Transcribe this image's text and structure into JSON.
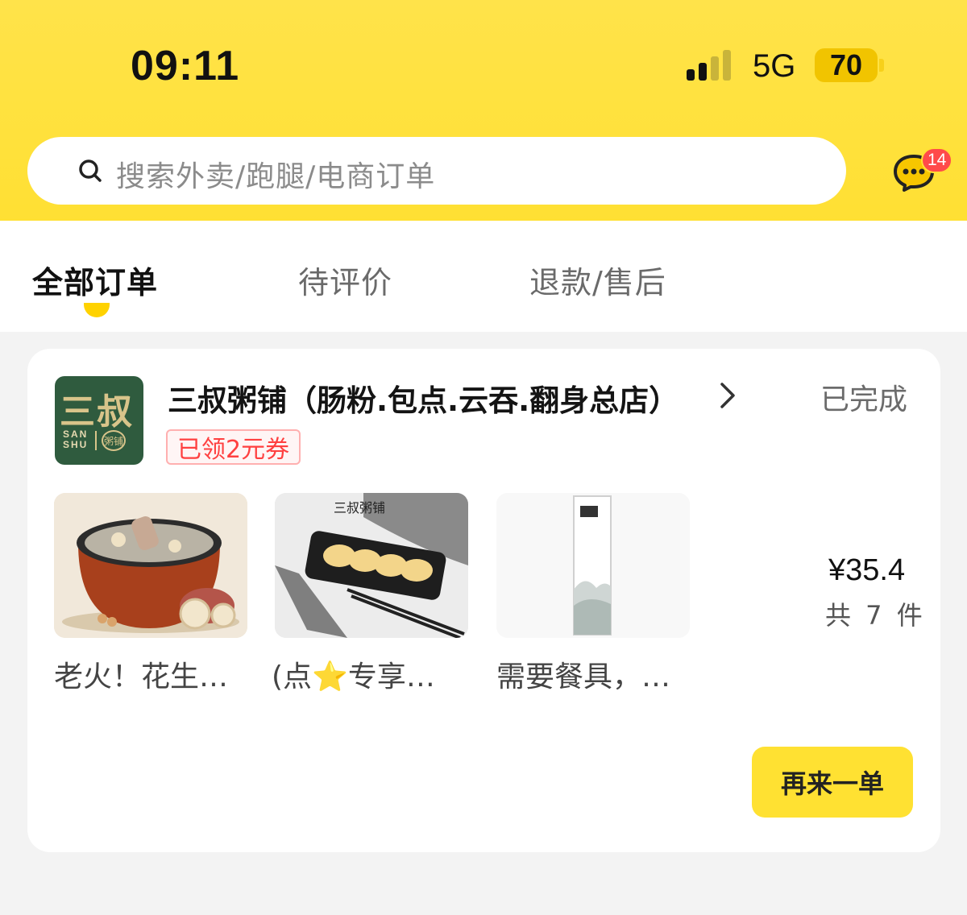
{
  "status_bar": {
    "time": "09:11",
    "network": "5G",
    "battery": "70"
  },
  "search": {
    "placeholder": "搜索外卖/跑腿/电商订单",
    "icon": "search-icon"
  },
  "messages": {
    "icon": "chat-bubble-icon",
    "badge": "14"
  },
  "tabs": [
    {
      "label": "全部订单",
      "active": true
    },
    {
      "label": "待评价",
      "active": false
    },
    {
      "label": "退款/售后",
      "active": false
    }
  ],
  "order": {
    "shop_logo": {
      "big": "三叔",
      "small_line1": "SAN",
      "small_line2": "SHU",
      "seal": "粥铺"
    },
    "shop_name": "三叔粥铺（肠粉.包点.云吞.翻身总店）",
    "status": "已完成",
    "coupon": "已领2元券",
    "items": [
      {
        "name": "老火！花生…"
      },
      {
        "name": "(点⭐专享…"
      },
      {
        "name": "需要餐具，…"
      }
    ],
    "thumb_text": {
      "item2_brand": "三叔粥铺"
    },
    "price": "¥35.4",
    "count": "共 7 件",
    "reorder_label": "再来一单"
  },
  "colors": {
    "header_yellow": "#ffe034",
    "accent_yellow": "#ffd200",
    "badge_red": "#ff4a4a",
    "shop_green": "#2f5b3e"
  }
}
